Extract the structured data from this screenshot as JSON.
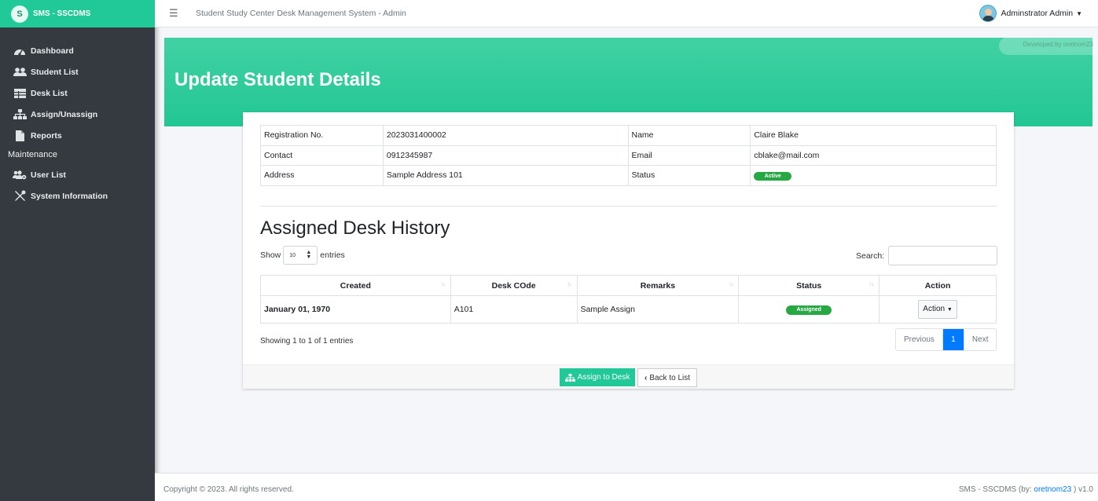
{
  "brand": {
    "initial": "S",
    "name": "SMS - SSCDMS"
  },
  "sidebar": {
    "items": [
      {
        "label": "Dashboard",
        "icon": "dashboard-icon"
      },
      {
        "label": "Student List",
        "icon": "users-icon"
      },
      {
        "label": "Desk List",
        "icon": "table-icon"
      },
      {
        "label": "Assign/Unassign",
        "icon": "sitemap-icon"
      },
      {
        "label": "Reports",
        "icon": "file-icon"
      }
    ],
    "maintenance_header": "Maintenance",
    "maintenance_items": [
      {
        "label": "User List",
        "icon": "users-cog-icon"
      },
      {
        "label": "System Information",
        "icon": "tools-icon"
      }
    ]
  },
  "topbar": {
    "title": "Student Study Center Desk Management System - Admin",
    "user_name": "Adminstrator Admin"
  },
  "banner": {
    "title": "Update Student Details",
    "developer_badge": "Developed by oretnom23"
  },
  "student": {
    "labels": {
      "registration": "Registration No.",
      "name": "Name",
      "contact": "Contact",
      "email": "Email",
      "address": "Address",
      "status": "Status"
    },
    "registration": "2023031400002",
    "name": "Claire Blake",
    "contact": "0912345987",
    "email": "cblake@mail.com",
    "address": "Sample Address 101",
    "status": "Active"
  },
  "history": {
    "title": "Assigned Desk History",
    "show_label": "Show",
    "entries_label": "entries",
    "page_size": "10",
    "search_label": "Search:",
    "columns": [
      "Created",
      "Desk COde",
      "Remarks",
      "Status",
      "Action"
    ],
    "rows": [
      {
        "created": "January 01, 1970",
        "desk_code": "A101",
        "remarks": "Sample Assign",
        "status": "Assigned",
        "action": "Action"
      }
    ],
    "showing_text": "Showing 1 to 1 of 1 entries",
    "pagination": {
      "previous": "Previous",
      "current": "1",
      "next": "Next"
    }
  },
  "buttons": {
    "assign": "Assign to Desk",
    "back": "Back to List"
  },
  "footer": {
    "copyright": "Copyright © 2023. All rights reserved.",
    "app_prefix": "SMS - SSCDMS (by: ",
    "author": "oretnom23",
    "app_suffix": " ) v1.0"
  },
  "colors": {
    "brand": "#20c997",
    "sidebar": "#343a40",
    "badge_success": "#28a745",
    "primary": "#007bff"
  }
}
